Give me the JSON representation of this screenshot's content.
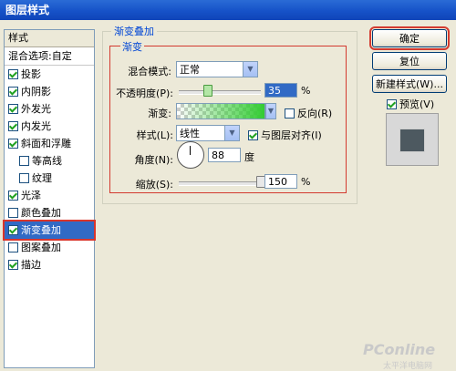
{
  "window": {
    "title": "图层样式"
  },
  "sidebar": {
    "header": "样式",
    "items": [
      {
        "label": "混合选项:自定",
        "checkbox": false,
        "sep": true
      },
      {
        "label": "投影",
        "checked": true
      },
      {
        "label": "内阴影",
        "checked": true
      },
      {
        "label": "外发光",
        "checked": true
      },
      {
        "label": "内发光",
        "checked": true
      },
      {
        "label": "斜面和浮雕",
        "checked": true
      },
      {
        "label": "等高线",
        "checked": false,
        "indent": true
      },
      {
        "label": "纹理",
        "checked": false,
        "indent": true
      },
      {
        "label": "光泽",
        "checked": true
      },
      {
        "label": "颜色叠加",
        "checked": false
      },
      {
        "label": "渐变叠加",
        "checked": true,
        "selected": true
      },
      {
        "label": "图案叠加",
        "checked": false
      },
      {
        "label": "描边",
        "checked": true
      }
    ]
  },
  "panel": {
    "title": "渐变叠加",
    "subtitle": "渐变",
    "blend_mode_label": "混合模式:",
    "blend_mode_value": "正常",
    "opacity_label": "不透明度(P):",
    "opacity_value": "35",
    "opacity_unit": "%",
    "opacity_fraction": 0.35,
    "gradient_label": "渐变:",
    "reverse_label": "反向(R)",
    "reverse_checked": false,
    "style_label": "样式(L):",
    "style_value": "线性",
    "align_label": "与图层对齐(I)",
    "align_checked": true,
    "angle_label": "角度(N):",
    "angle_value": "88",
    "angle_unit": "度",
    "scale_label": "缩放(S):",
    "scale_value": "150",
    "scale_unit": "%",
    "scale_fraction": 1.0
  },
  "buttons": {
    "ok": "确定",
    "reset": "复位",
    "new_style": "新建样式(W)...",
    "preview_label": "预览(V)",
    "preview_checked": true
  },
  "watermark": {
    "brand": "PConline",
    "sub": "太平洋电脑网"
  }
}
